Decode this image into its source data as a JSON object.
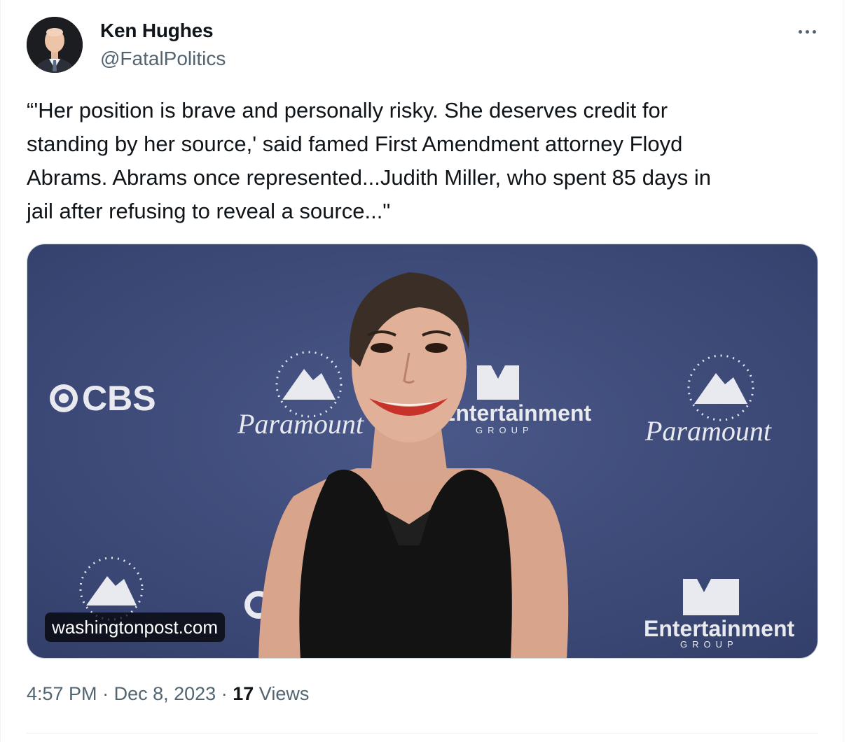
{
  "author": {
    "name": "Ken Hughes",
    "handle": "@FatalPolitics",
    "avatar_icon": "person-avatar"
  },
  "more_icon": "more-horizontal-icon",
  "tweet": {
    "text": "“'Her position is brave and personally risky. She deserves credit for\nstanding by her source,' said famed First Amendment attorney Floyd\nAbrams. Abrams once represented...Judith Miller, who spent 85 days in\njail after refusing to reveal a source...\""
  },
  "media": {
    "source_label": "washingtonpost.com",
    "backdrop_logos": {
      "cbs": "CBS",
      "paramount": "Paramount",
      "mtv_entertainment": "Entertainment",
      "mtv_group": "GROUP"
    }
  },
  "meta": {
    "time": "4:57 PM",
    "separator": "·",
    "date": "Dec 8, 2023",
    "views_count": "17",
    "views_label": "Views"
  },
  "colors": {
    "text_primary": "#0f1419",
    "text_secondary": "#536471",
    "backdrop_navy": "#3f4d7c",
    "border": "#cfd9de"
  }
}
